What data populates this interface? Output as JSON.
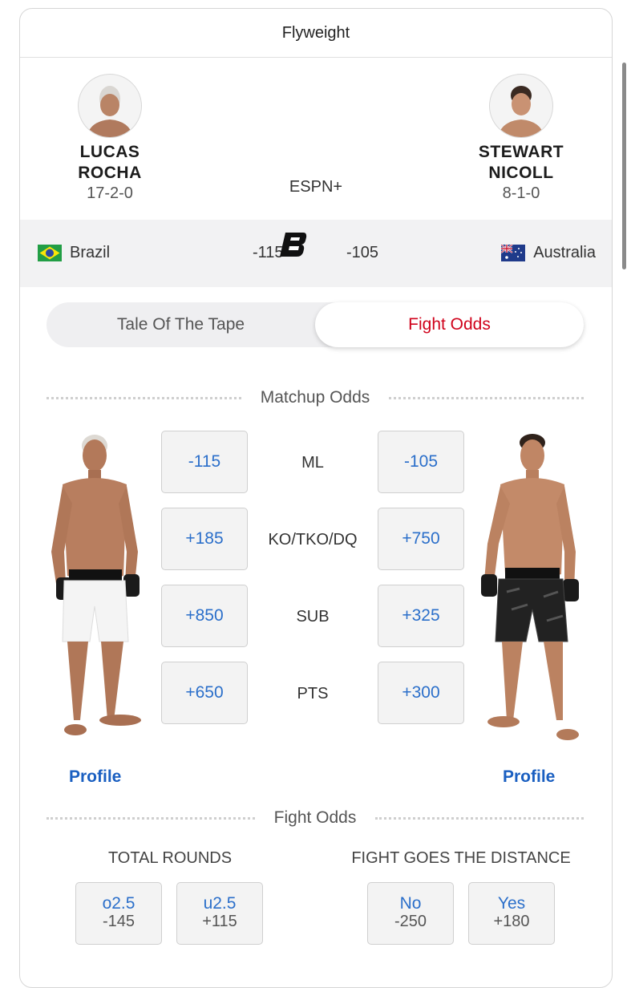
{
  "division": "Flyweight",
  "network": "ESPN+",
  "fighter_left": {
    "first": "LUCAS",
    "last": "ROCHA",
    "record": "17-2-0",
    "country": "Brazil",
    "line": "-115",
    "profile": "Profile"
  },
  "fighter_right": {
    "first": "STEWART",
    "last": "NICOLL",
    "record": "8-1-0",
    "country": "Australia",
    "line": "-105",
    "profile": "Profile"
  },
  "bet_logo": "espn-bet-logo",
  "tabs": {
    "tape": "Tale Of The Tape",
    "odds": "Fight Odds",
    "active": "odds"
  },
  "matchup": {
    "title": "Matchup Odds",
    "rows": [
      {
        "label": "ML",
        "left": "-115",
        "right": "-105"
      },
      {
        "label": "KO/TKO/DQ",
        "left": "+185",
        "right": "+750"
      },
      {
        "label": "SUB",
        "left": "+850",
        "right": "+325"
      },
      {
        "label": "PTS",
        "left": "+650",
        "right": "+300"
      }
    ]
  },
  "fight_odds": {
    "title": "Fight Odds",
    "total_rounds": {
      "title": "TOTAL ROUNDS",
      "options": [
        {
          "top": "o2.5",
          "bottom": "-145"
        },
        {
          "top": "u2.5",
          "bottom": "+115"
        }
      ]
    },
    "distance": {
      "title": "FIGHT GOES THE DISTANCE",
      "options": [
        {
          "top": "No",
          "bottom": "-250"
        },
        {
          "top": "Yes",
          "bottom": "+180"
        }
      ]
    }
  },
  "colors": {
    "accent_red": "#d0021b",
    "link_blue": "#1a5fc1",
    "odds_blue": "#2b6fca"
  }
}
